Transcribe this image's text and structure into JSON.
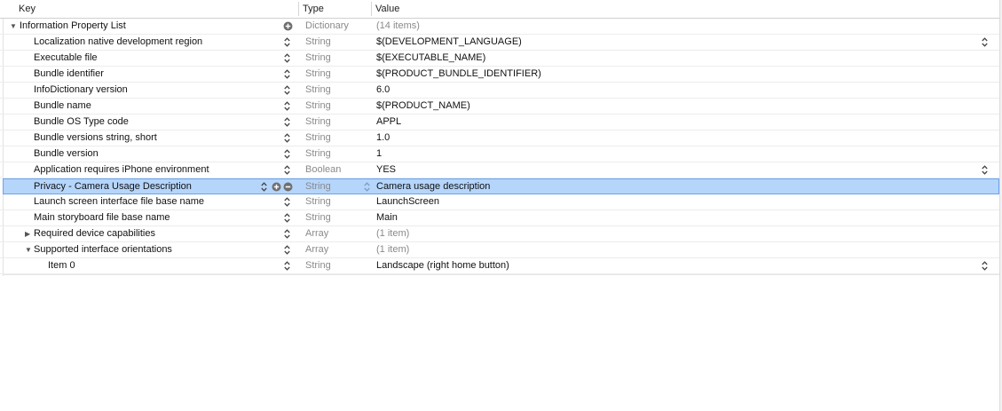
{
  "header": {
    "key_label": "Key",
    "type_label": "Type",
    "value_label": "Value"
  },
  "rows": [
    {
      "key": "Information Property List",
      "type": "Dictionary",
      "value": "(14 items)",
      "disclosure": "expanded",
      "level": 0,
      "value_muted": true
    },
    {
      "key": "Localization native development region",
      "type": "String",
      "value": "$(DEVELOPMENT_LANGUAGE)",
      "level": 1,
      "popup": true
    },
    {
      "key": "Executable file",
      "type": "String",
      "value": "$(EXECUTABLE_NAME)",
      "level": 1
    },
    {
      "key": "Bundle identifier",
      "type": "String",
      "value": "$(PRODUCT_BUNDLE_IDENTIFIER)",
      "level": 1
    },
    {
      "key": "InfoDictionary version",
      "type": "String",
      "value": "6.0",
      "level": 1
    },
    {
      "key": "Bundle name",
      "type": "String",
      "value": "$(PRODUCT_NAME)",
      "level": 1
    },
    {
      "key": "Bundle OS Type code",
      "type": "String",
      "value": "APPL",
      "level": 1
    },
    {
      "key": "Bundle versions string, short",
      "type": "String",
      "value": "1.0",
      "level": 1
    },
    {
      "key": "Bundle version",
      "type": "String",
      "value": "1",
      "level": 1
    },
    {
      "key": "Application requires iPhone environment",
      "type": "Boolean",
      "value": "YES",
      "level": 1,
      "popup": true
    },
    {
      "key": "Privacy - Camera Usage Description",
      "type": "String",
      "value": "Camera usage description",
      "level": 1,
      "selected": true
    },
    {
      "key": "Launch screen interface file base name",
      "type": "String",
      "value": "LaunchScreen",
      "level": 1
    },
    {
      "key": "Main storyboard file base name",
      "type": "String",
      "value": "Main",
      "level": 1
    },
    {
      "key": "Required device capabilities",
      "type": "Array",
      "value": "(1 item)",
      "disclosure": "collapsed",
      "level": 1,
      "value_muted": true
    },
    {
      "key": "Supported interface orientations",
      "type": "Array",
      "value": "(1 item)",
      "disclosure": "expanded",
      "level": 1,
      "value_muted": true
    },
    {
      "key": "Item 0",
      "type": "String",
      "value": "Landscape (right home button)",
      "level": 2,
      "popup": true
    }
  ],
  "icons": {
    "stepper": "up-down-chevron-icon",
    "add": "plus-circle-icon",
    "remove": "minus-circle-icon",
    "disclosure_expanded": "triangle-down-icon",
    "disclosure_collapsed": "triangle-right-icon"
  },
  "colors": {
    "selection_bg": "#b5d5fb",
    "selection_border": "#6aa4ea",
    "muted_text": "#8a8a8a"
  }
}
